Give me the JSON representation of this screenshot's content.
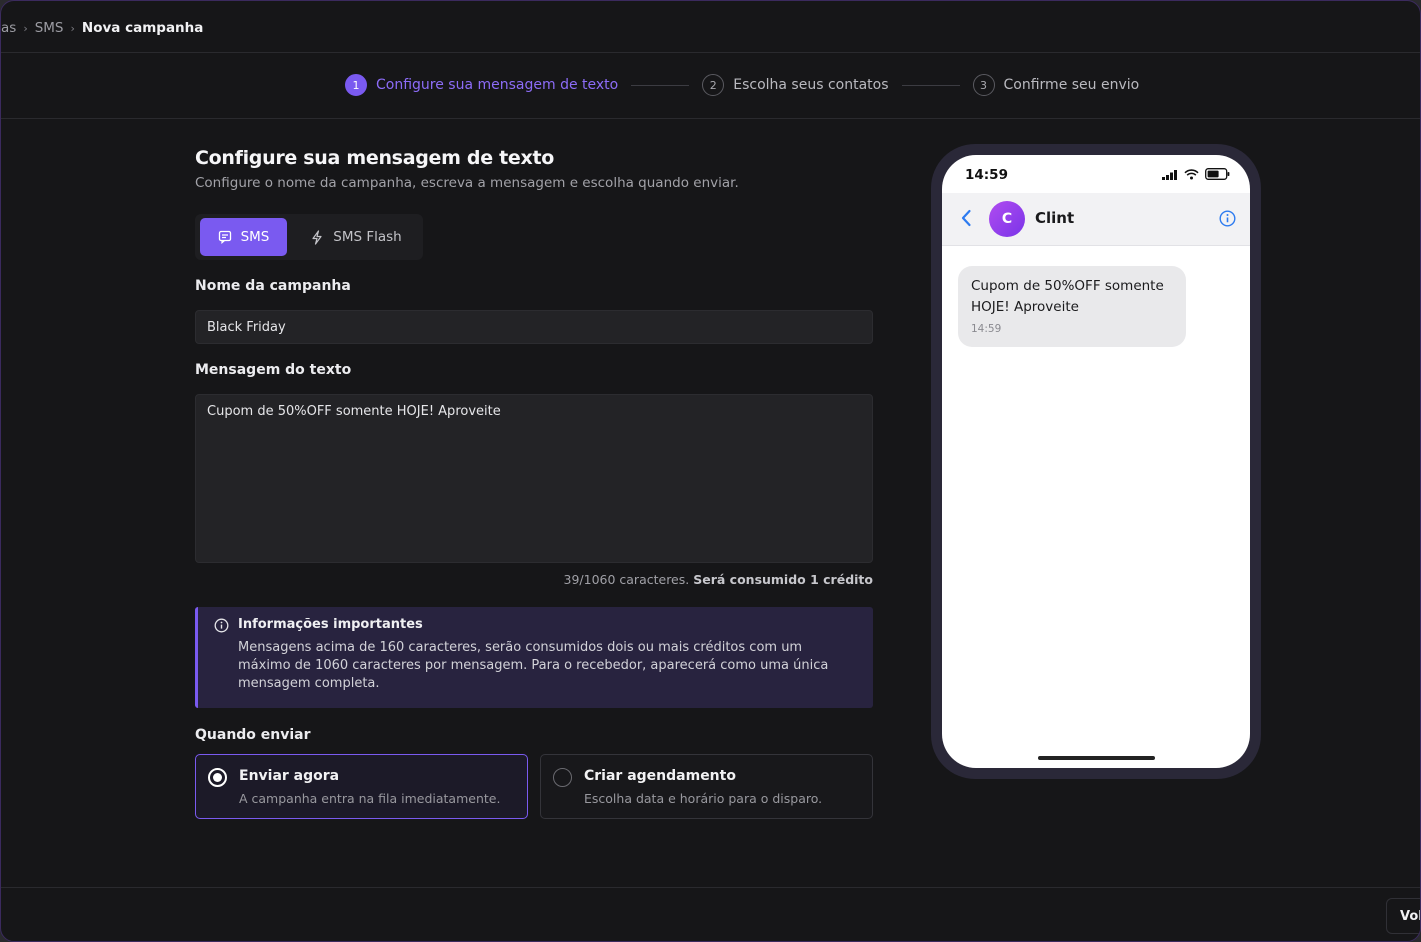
{
  "breadcrumb": {
    "parent": "as",
    "section": "SMS",
    "current": "Nova campanha"
  },
  "stepper": [
    {
      "num": "1",
      "label": "Configure sua mensagem de texto",
      "active": true
    },
    {
      "num": "2",
      "label": "Escolha seus contatos",
      "active": false
    },
    {
      "num": "3",
      "label": "Confirme seu envio",
      "active": false
    }
  ],
  "form": {
    "title": "Configure sua mensagem de texto",
    "subtitle": "Configure o nome da campanha, escreva a mensagem e escolha quando enviar.",
    "tabs": {
      "sms": "SMS",
      "flash": "SMS Flash"
    },
    "campaign_name_label": "Nome da campanha",
    "campaign_name_value": "Black Friday",
    "message_label": "Mensagem do texto",
    "message_value": "Cupom de 50%OFF somente HOJE! Aproveite",
    "counter": "39/1060 caracteres.",
    "credit": "Será consumido 1 crédito",
    "notice": {
      "title": "Informações importantes",
      "text": "Mensagens acima de 160 caracteres, serão consumidos dois ou mais créditos com um máximo de 1060 caracteres por mensagem. Para o recebedor, aparecerá como uma única mensagem completa."
    },
    "when_label": "Quando enviar",
    "options": [
      {
        "title": "Enviar agora",
        "desc": "A campanha entra na fila imediatamente.",
        "selected": true
      },
      {
        "title": "Criar agendamento",
        "desc": "Escolha data e horário para o disparo.",
        "selected": false
      }
    ]
  },
  "preview": {
    "time": "14:59",
    "avatar_letter": "C",
    "contact": "Clint",
    "message": "Cupom de 50%OFF somente HOJE! Aproveite",
    "message_time": "14:59"
  },
  "footer": {
    "back_button": "Vol"
  },
  "colors": {
    "accent": "#7a5af0",
    "background": "#161618",
    "notice_bg": "#28233f"
  }
}
